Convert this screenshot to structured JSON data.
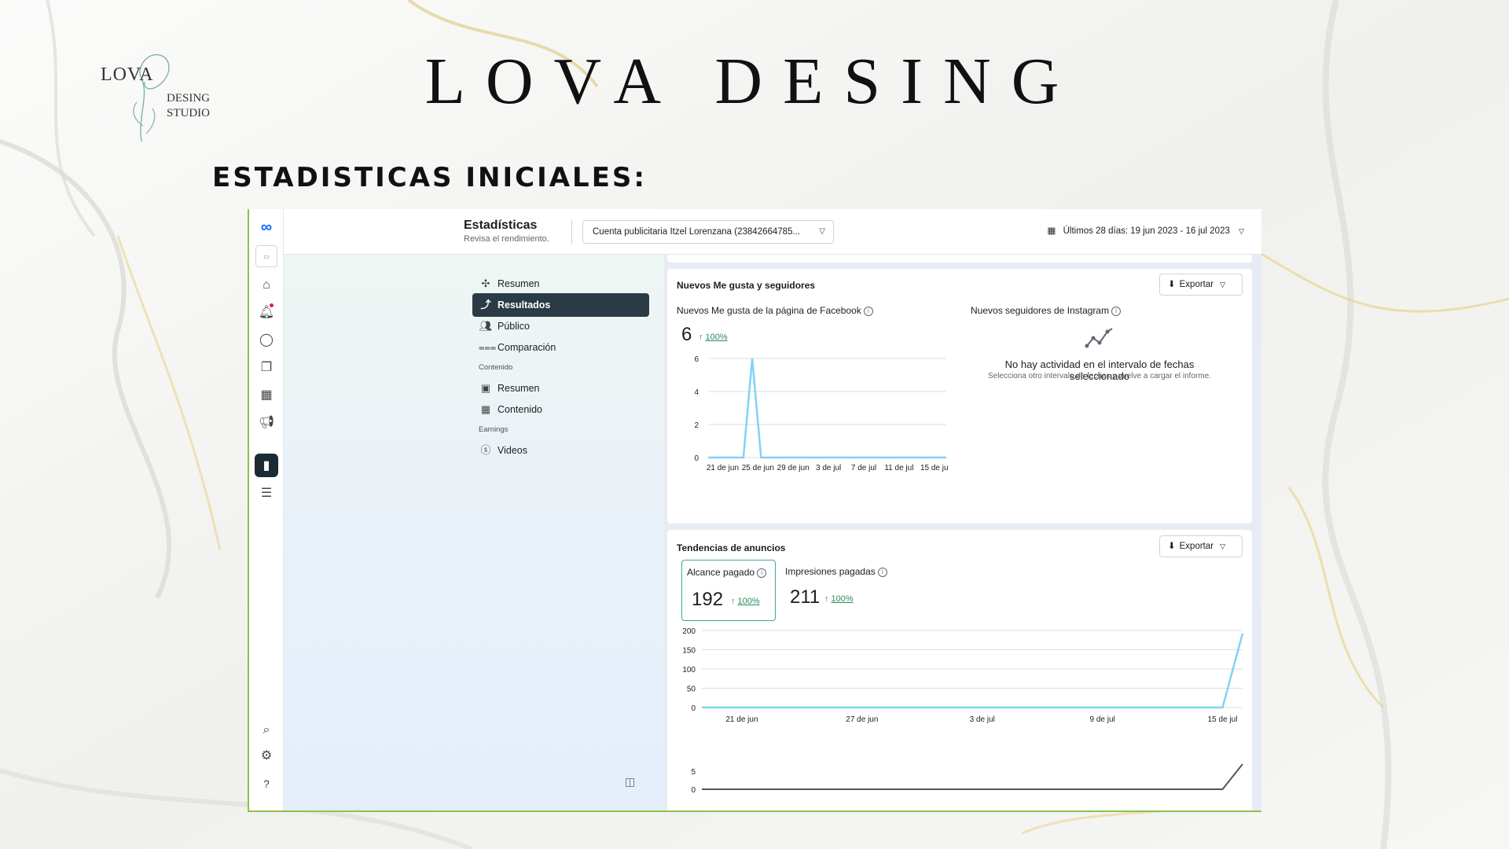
{
  "brand": {
    "logo_main": "LOVA",
    "logo_sub_line1": "DESING",
    "logo_sub_line2": "STUDIO",
    "title": "LOVA DESING"
  },
  "section_heading": "ESTADISTICAS INICIALES:",
  "topbar": {
    "title": "Estadísticas",
    "subtitle": "Revisa el rendimiento.",
    "account": "Cuenta publicitaria Itzel Lorenzana (23842664785...",
    "date_range": "Últimos 28 días: 19 jun 2023 - 16 jul 2023"
  },
  "icon_sidebar": [
    {
      "icon": "home-icon"
    },
    {
      "icon": "bell-icon"
    },
    {
      "icon": "chat-icon"
    },
    {
      "icon": "pages-icon"
    },
    {
      "icon": "table-icon"
    },
    {
      "icon": "megaphone-icon"
    },
    {
      "icon": "bar-chart-icon",
      "active": true
    },
    {
      "icon": "menu-icon"
    },
    {
      "icon": "search-icon"
    },
    {
      "icon": "gear-icon"
    },
    {
      "icon": "help-icon"
    }
  ],
  "nav": {
    "items": [
      {
        "label": "Resumen",
        "icon": "overview-icon"
      },
      {
        "label": "Resultados",
        "icon": "trend-icon",
        "active": true
      },
      {
        "label": "Público",
        "icon": "people-icon"
      },
      {
        "label": "Comparación",
        "icon": "compare-icon"
      }
    ],
    "section_content": "Contenido",
    "content_items": [
      {
        "label": "Resumen",
        "icon": "content-overview-icon"
      },
      {
        "label": "Contenido",
        "icon": "table-icon"
      }
    ],
    "section_earnings": "Earnings",
    "earnings_items": [
      {
        "label": "Videos",
        "icon": "dollar-icon"
      }
    ]
  },
  "likes_card": {
    "title": "Nuevos Me gusta y seguidores",
    "export_label": "Exportar",
    "fb_label": "Nuevos Me gusta de la página de Facebook",
    "fb_value": "6",
    "fb_change": "100%",
    "ig_label": "Nuevos seguidores de Instagram",
    "empty_title": "No hay actividad en el intervalo de fechas seleccionado",
    "empty_sub": "Selecciona otro intervalo de fechas y vuelve a cargar el informe."
  },
  "ads_card": {
    "title": "Tendencias de anuncios",
    "export_label": "Exportar",
    "reach_label": "Alcance pagado",
    "reach_value": "192",
    "reach_change": "100%",
    "impr_label": "Impresiones pagadas",
    "impr_value": "211",
    "impr_change": "100%"
  },
  "colors": {
    "accent_line": "#7fd3f7",
    "dark_line": "#555555",
    "active_nav": "#2b3b45",
    "positive": "#2a8c5b",
    "frame_border": "#8bc34a"
  },
  "chart_data": [
    {
      "type": "line",
      "title": "Nuevos Me gusta de la página de Facebook",
      "x": [
        "19 jun",
        "20 jun",
        "21 jun",
        "22 jun",
        "23 jun",
        "24 jun",
        "25 jun",
        "26 jun",
        "27 jun",
        "28 jun",
        "29 jun",
        "30 jun",
        "1 jul",
        "2 jul",
        "3 jul",
        "4 jul",
        "5 jul",
        "6 jul",
        "7 jul",
        "8 jul",
        "9 jul",
        "10 jul",
        "11 jul",
        "12 jul",
        "13 jul",
        "14 jul",
        "15 jul",
        "16 jul"
      ],
      "tick_labels": [
        "21 de jun",
        "25 de jun",
        "29 de jun",
        "3 de jul",
        "7 de jul",
        "11 de jul",
        "15 de ju"
      ],
      "series": [
        {
          "values": [
            0,
            0,
            0,
            0,
            0,
            6,
            0,
            0,
            0,
            0,
            0,
            0,
            0,
            0,
            0,
            0,
            0,
            0,
            0,
            0,
            0,
            0,
            0,
            0,
            0,
            0,
            0,
            0
          ]
        }
      ],
      "ylim": [
        0,
        6
      ],
      "yticks": [
        0,
        2,
        4,
        6
      ],
      "grid": true
    },
    {
      "type": "line",
      "title": "Tendencias de anuncios",
      "x": [
        "19 jun",
        "20 jun",
        "21 jun",
        "22 jun",
        "23 jun",
        "24 jun",
        "25 jun",
        "26 jun",
        "27 jun",
        "28 jun",
        "29 jun",
        "30 jun",
        "1 jul",
        "2 jul",
        "3 jul",
        "4 jul",
        "5 jul",
        "6 jul",
        "7 jul",
        "8 jul",
        "9 jul",
        "10 jul",
        "11 jul",
        "12 jul",
        "13 jul",
        "14 jul",
        "15 jul",
        "16 jul"
      ],
      "tick_labels": [
        "21 de jun",
        "27 de jun",
        "3 de jul",
        "9 de jul",
        "15 de jul"
      ],
      "series": [
        {
          "name": "Alcance pagado",
          "values": [
            0,
            0,
            0,
            0,
            0,
            0,
            0,
            0,
            0,
            0,
            0,
            0,
            0,
            0,
            0,
            0,
            0,
            0,
            0,
            0,
            0,
            0,
            0,
            0,
            0,
            0,
            0,
            192
          ]
        }
      ],
      "ylim": [
        0,
        200
      ],
      "yticks": [
        0,
        50,
        100,
        150,
        200
      ],
      "grid": true
    },
    {
      "type": "line",
      "x": [
        "19 jun",
        "20 jun",
        "21 jun",
        "22 jun",
        "23 jun",
        "24 jun",
        "25 jun",
        "26 jun",
        "27 jun",
        "28 jun",
        "29 jun",
        "30 jun",
        "1 jul",
        "2 jul",
        "3 jul",
        "4 jul",
        "5 jul",
        "6 jul",
        "7 jul",
        "8 jul",
        "9 jul",
        "10 jul",
        "11 jul",
        "12 jul",
        "13 jul",
        "14 jul",
        "15 jul",
        "16 jul"
      ],
      "series": [
        {
          "values": [
            0,
            0,
            0,
            0,
            0,
            0,
            0,
            0,
            0,
            0,
            0,
            0,
            0,
            0,
            0,
            0,
            0,
            0,
            0,
            0,
            0,
            0,
            0,
            0,
            0,
            0,
            0,
            7
          ]
        }
      ],
      "ylim": [
        0,
        7
      ],
      "yticks": [
        0,
        5
      ],
      "grid": false
    }
  ]
}
